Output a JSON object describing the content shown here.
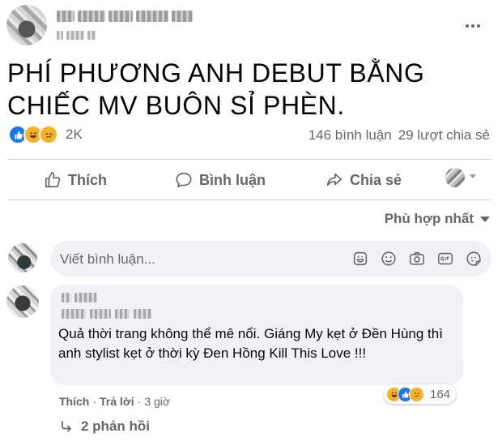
{
  "post": {
    "text": "PHÍ PHƯƠNG ANH DEBUT BẰNG CHIẾC MV BUÔN SỈ PHÈN.",
    "reactions": [
      "like",
      "haha",
      "sad"
    ],
    "reaction_count": "2K",
    "comments_count": "146 bình luận",
    "shares_count": "29 lượt chia sẻ"
  },
  "actions": {
    "like": "Thích",
    "comment": "Bình luận",
    "share": "Chia sẻ"
  },
  "sort": {
    "label": "Phù hợp nhất"
  },
  "composer": {
    "placeholder": "Viết bình luận..."
  },
  "comment": {
    "text": "Quả thời trang không thể mê nổi. Giáng My kẹt ở Đền Hùng thì anh stylist kẹt ở thời kỳ Đen Hồng Kill This Love !!!",
    "like_action": "Thích",
    "reply_action": "Trả lời",
    "separator": "·",
    "time": "3 giờ",
    "reactions": [
      "haha",
      "like",
      "sad"
    ],
    "reaction_count": "164",
    "replies_label": "2 phản hồi"
  },
  "icons": {
    "more": "more-dots-icon",
    "like": "thumbs-up-icon",
    "comment": "speech-bubble-icon",
    "share": "share-arrow-icon",
    "sticker": "sticker-icon",
    "emoji": "smiley-icon",
    "camera": "camera-icon",
    "gif": "gif-icon",
    "avatar_sticker": "avatar-sticker-icon",
    "reply_arrow": "reply-arrow-icon"
  },
  "colors": {
    "like_blue": "#1877f2",
    "reaction_yellow": "#f7b125",
    "secondary_text": "#65676b",
    "bubble_bg": "#f0f2f5"
  }
}
